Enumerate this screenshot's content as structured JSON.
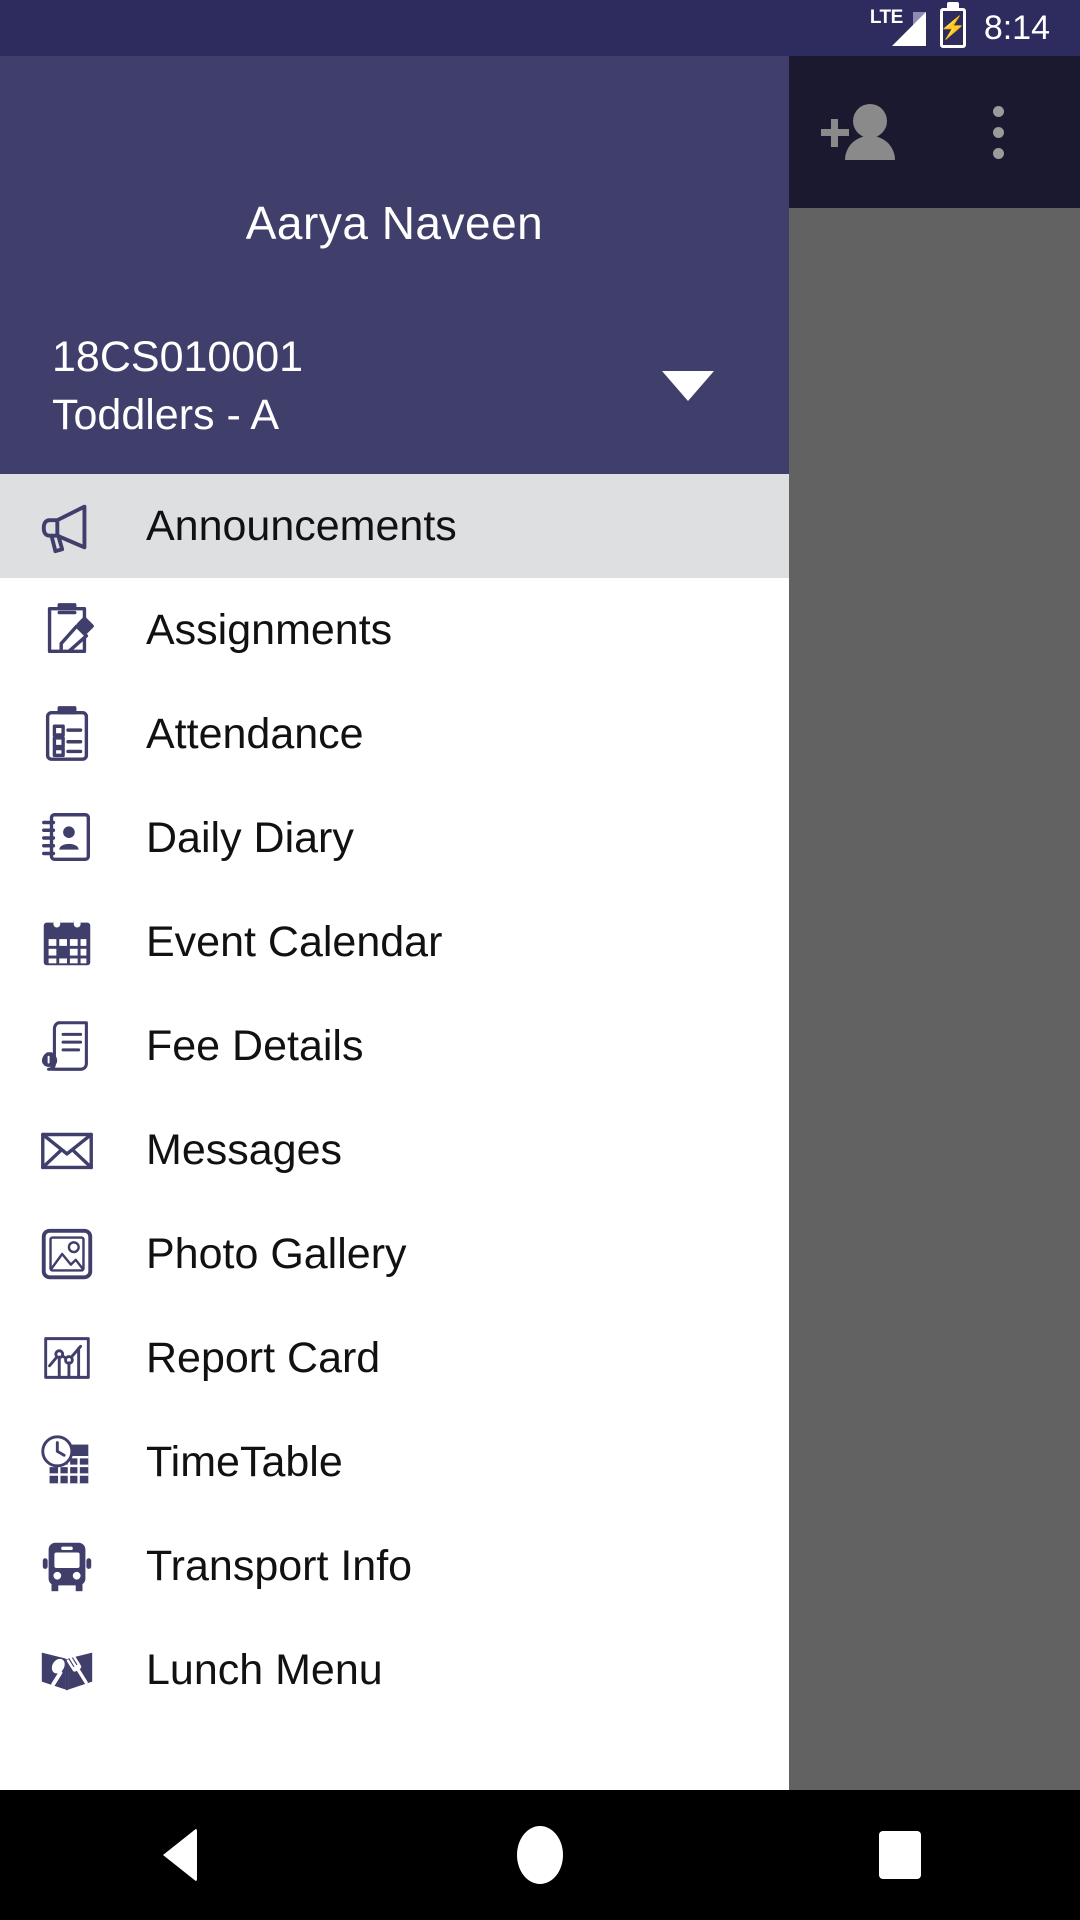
{
  "status_bar": {
    "network_label": "LTE",
    "network_icon": "signal-bars-icon",
    "battery_icon": "battery-charging-icon",
    "time": "8:14",
    "background_color": "#2E2C5F"
  },
  "app_toolbar": {
    "background_color": "#1B1930",
    "actions": [
      {
        "name": "add-person",
        "icon": "add-person-icon"
      },
      {
        "name": "overflow-menu",
        "icon": "more-vertical-icon"
      }
    ]
  },
  "drawer": {
    "background_color": "#FFFFFF",
    "header": {
      "background_color": "#403E6B",
      "student_name": "Aarya   Naveen",
      "admission_number": "18CS010001",
      "class_section": "Toddlers - A",
      "switch_icon": "chevron-down-icon"
    },
    "selected_item": "Announcements",
    "selected_background_color": "#DEDFE1",
    "accent_color": "#403E6B",
    "items": [
      {
        "label": "Announcements",
        "icon": "megaphone-icon",
        "selected": true
      },
      {
        "label": "Assignments",
        "icon": "clipboard-pencil-icon",
        "selected": false
      },
      {
        "label": "Attendance",
        "icon": "clipboard-checklist-icon",
        "selected": false
      },
      {
        "label": "Daily Diary",
        "icon": "contact-book-icon",
        "selected": false
      },
      {
        "label": "Event Calendar",
        "icon": "calendar-icon",
        "selected": false
      },
      {
        "label": "Fee Details",
        "icon": "invoice-money-icon",
        "selected": false
      },
      {
        "label": "Messages",
        "icon": "envelope-icon",
        "selected": false
      },
      {
        "label": "Photo Gallery",
        "icon": "photo-frame-icon",
        "selected": false
      },
      {
        "label": "Report Card",
        "icon": "chart-report-icon",
        "selected": false
      },
      {
        "label": "TimeTable",
        "icon": "clock-grid-icon",
        "selected": false
      },
      {
        "label": "Transport Info",
        "icon": "bus-icon",
        "selected": false
      },
      {
        "label": "Lunch Menu",
        "icon": "menu-book-cutlery-icon",
        "selected": false
      }
    ]
  },
  "scrim": {
    "color": "#626262"
  },
  "nav_bar": {
    "background_color": "#000000",
    "buttons": [
      {
        "name": "back",
        "icon": "back-triangle-icon"
      },
      {
        "name": "home",
        "icon": "home-circle-icon"
      },
      {
        "name": "recents",
        "icon": "recents-square-icon"
      }
    ]
  }
}
